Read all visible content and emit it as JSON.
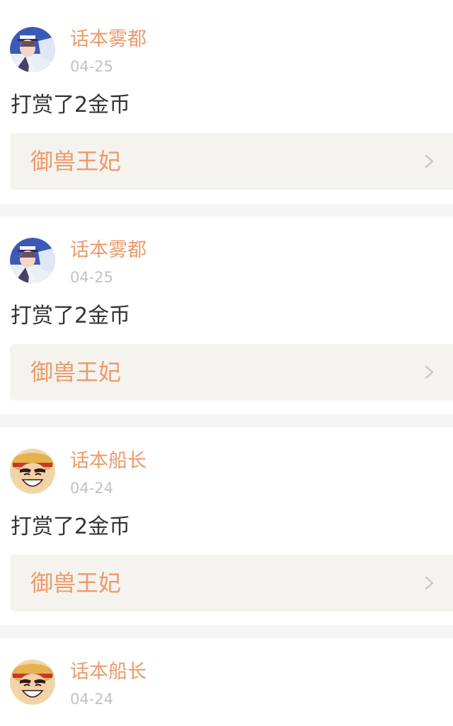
{
  "feed": {
    "items": [
      {
        "username": "话本雾都",
        "date": "04-25",
        "action": "打赏了2金币",
        "book": "御兽王妃",
        "avatar_icon": "anime-gentleman-thief-avatar"
      },
      {
        "username": "话本雾都",
        "date": "04-25",
        "action": "打赏了2金币",
        "book": "御兽王妃",
        "avatar_icon": "anime-gentleman-thief-avatar"
      },
      {
        "username": "话本船长",
        "date": "04-24",
        "action": "打赏了2金币",
        "book": "御兽王妃",
        "avatar_icon": "anime-straw-hat-avatar"
      },
      {
        "username": "话本船长",
        "date": "04-24",
        "action": "",
        "book": "",
        "avatar_icon": "anime-straw-hat-avatar"
      }
    ]
  },
  "colors": {
    "accent": "#ec9a6a",
    "date": "#c2c2c2",
    "text": "#333333",
    "card_background": "#ffffff",
    "page_background": "#f5f5f5",
    "book_link_background": "#f4f3ee"
  }
}
